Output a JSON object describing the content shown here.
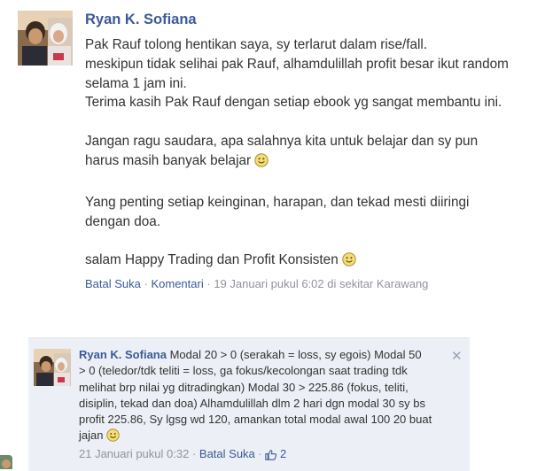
{
  "post": {
    "author": "Ryan K. Sofiana",
    "lines": [
      "Pak Rauf tolong hentikan saya, sy terlarut dalam rise/fall.",
      "meskipun tidak selihai pak Rauf, alhamdulillah profit besar ikut random",
      "selama 1 jam ini.",
      "Terima kasih Pak Rauf dengan setiap ebook yg sangat membantu ini.",
      "",
      "Jangan ragu saudara, apa salahnya kita untuk belajar dan sy pun",
      "harus masih banyak belajar",
      "",
      "Yang penting setiap keinginan, harapan, dan tekad mesti diiringi",
      "dengan doa.",
      "",
      "salam Happy Trading dan Profit Konsisten"
    ],
    "unlike_label": "Batal Suka",
    "separator": "·",
    "comment_label": "Komentari",
    "timestamp": "19 Januari pukul 6:02 di sekitar Karawang"
  },
  "comment": {
    "author": "Ryan K. Sofiana",
    "text_line1": "Modal 20 > 0 (serakah = loss, sy egois) Modal 50",
    "text_lines": [
      "> 0 (teledor/tdk teliti = loss, ga fokus/kecolongan saat trading tdk",
      "melihat brp nilai yg ditradingkan) Modal 30 > 225.86 (fokus, teliti,",
      "disiplin, tekad dan doa) Alhamdulillah dlm 2 hari dgn modal 30 sy bs",
      "profit 225.86, Sy lgsg wd 120, amankan total modal awal 100 20 buat",
      "jajan"
    ],
    "close_symbol": "✕",
    "timestamp": "21 Januari pukul 0:32",
    "separator": "·",
    "unlike_label": "Batal Suka",
    "like_count": "2",
    "icons": [
      "smiley-icon",
      "thumbs-up-icon",
      "close-icon"
    ]
  }
}
